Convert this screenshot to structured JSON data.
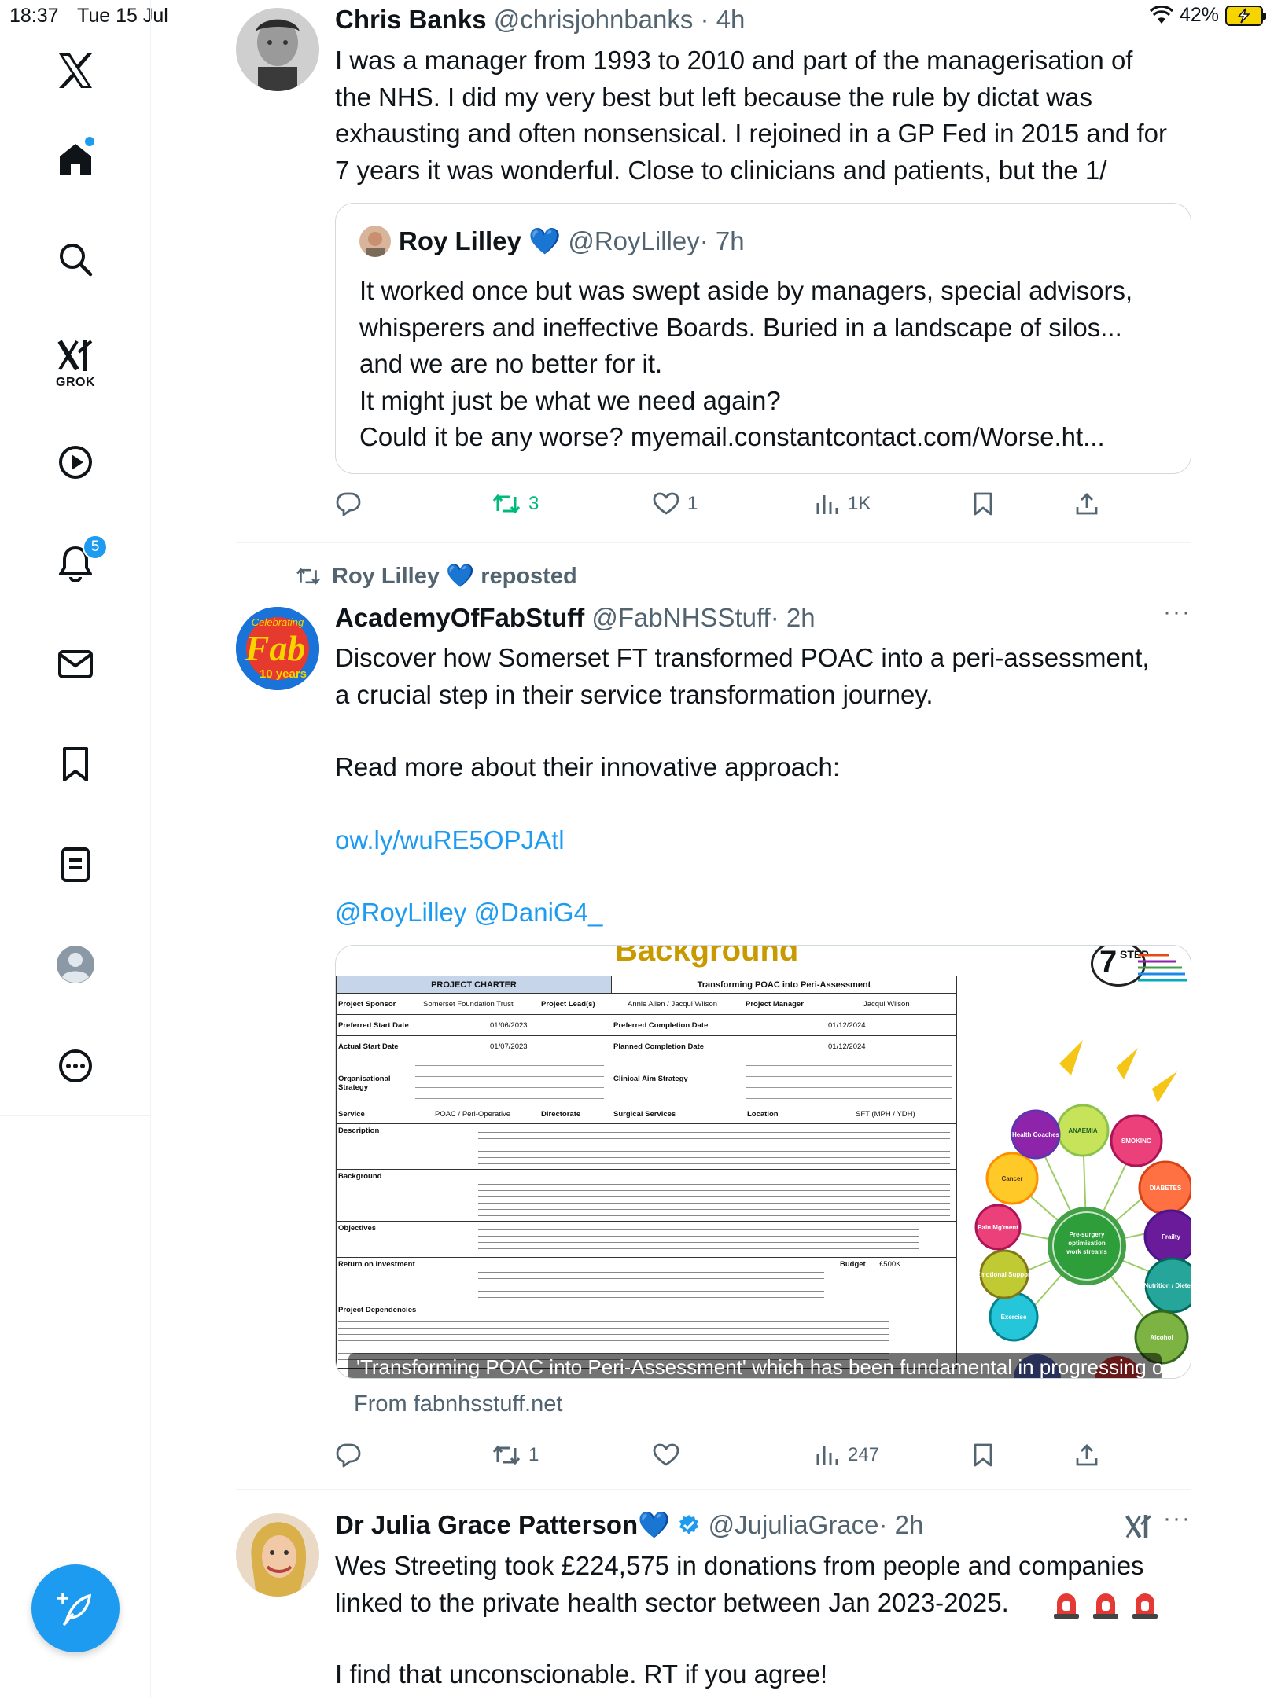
{
  "status_bar": {
    "time": "18:37",
    "date": "Tue 15 Jul",
    "battery": "42%"
  },
  "nav": {
    "grok_label": "GROK",
    "notifications_count": "5"
  },
  "tweets": [
    {
      "name": "Chris Banks",
      "handle": "@chrisjohnbanks",
      "time": "· 4h",
      "text": "I was a manager from 1993 to 2010 and part of the managerisation of\nthe NHS. I did my very best but left because the rule by dictat was\nexhausting and often nonsensical. I rejoined in a GP Fed in 2015 and for\n7 years it was wonderful. Close to clinicians and patients, but the 1/",
      "quote": {
        "name": "Roy Lilley",
        "heart": "💙",
        "handle": "@RoyLilley",
        "time": "· 7h",
        "text": "It worked once but was swept aside by managers, special advisors,\nwhisperers and ineffective Boards. Buried in a landscape of silos...\nand we are no better for it.\nIt might just be what we need again?\nCould it be any worse?   myemail.constantcontact.com/Worse.ht..."
      },
      "stats": {
        "replies": "",
        "reposts": "3",
        "likes": "1",
        "views": "1K"
      }
    },
    {
      "repost_by": "Roy Lilley 💙 reposted",
      "name": "AcademyOfFabStuff",
      "handle": "@FabNHSStuff",
      "time": "· 2h",
      "text_1": "Discover how Somerset FT transformed POAC into a peri-assessment,\na crucial step in their service transformation journey.",
      "text_2": "Read more about their innovative approach:",
      "link": "ow.ly/wuRE5OPJAtl",
      "mentions": "@RoyLilley @DaniG4_",
      "avatar_text_1": "Celebrating",
      "avatar_text_2": "Fab",
      "avatar_text_3": "10 years",
      "card": {
        "title": "Background",
        "caption": "'Transforming POAC into Peri-Assessment' which has been fundamental in progressing our...",
        "source": "From fabnhsstuff.net",
        "charter_head_left": "PROJECT CHARTER",
        "charter_head_right": "Transforming POAC into Peri-Assessment",
        "rows": [
          [
            "Project Sponsor",
            "Somerset Foundation Trust",
            "Project Lead(s)",
            "Annie Allen / Jacqui Wilson",
            "Project Manager",
            "Jacqui Wilson"
          ],
          [
            "Preferred Start Date",
            "01/06/2023",
            "Preferred Completion Date",
            "01/12/2024"
          ],
          [
            "Actual Start Date",
            "01/07/2023",
            "Planned Completion Date",
            "01/12/2024"
          ]
        ],
        "labels": [
          "Organisational Strategy",
          "Service",
          "Description",
          "Background",
          "Objectives",
          "Return on Investment",
          "Project Dependencies"
        ],
        "service_value": "POAC / Peri-Operative",
        "directorate": "Directorate",
        "directorate_value": "Surgical Services",
        "location": "Location",
        "location_value": "SFT (MPH / YDH)",
        "clinical_aim": "Clinical Aim Strategy",
        "budget": "Budget",
        "budget_value": "£500K",
        "logo_num": "7",
        "logo_text": "STEP",
        "hub": "Pre-surgery optimisation work streams",
        "bubbles": [
          "ANAEMIA",
          "SMOKING",
          "DIABETES",
          "Frailty",
          "Nutrition / Dietetics",
          "Alcohol",
          "Exercise",
          "Emotional Support",
          "Pain Mg'ment",
          "Cancer",
          "Health Coaches"
        ]
      },
      "stats": {
        "replies": "",
        "reposts": "1",
        "likes": "",
        "views": "247"
      }
    },
    {
      "name": "Dr Julia Grace Patterson",
      "heart": "💙",
      "handle": "@JujuliaGrace",
      "time": "· 2h",
      "text_1": "Wes Streeting took £224,575 in donations from people and companies\nlinked to the private health sector between Jan 2023-2025.",
      "text_2": "I find that unconscionable. RT if you agree!"
    }
  ],
  "colors": {
    "accent": "#1d9bf0",
    "text": "#0f1419",
    "muted": "#536471",
    "repost_green": "#00ba7c"
  }
}
